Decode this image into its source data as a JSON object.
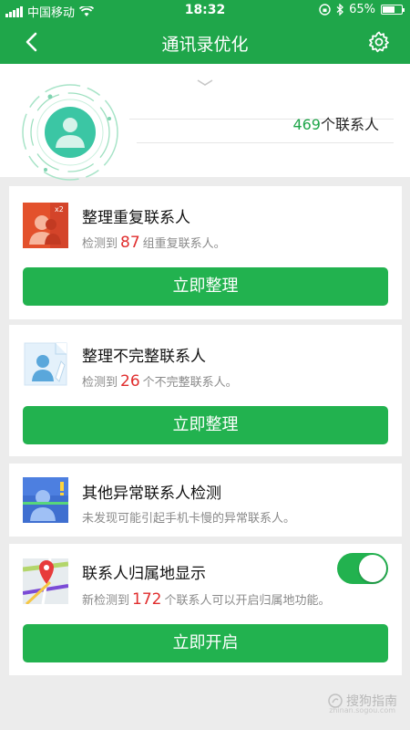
{
  "status": {
    "carrier": "中国移动",
    "time": "18:32",
    "battery": "65%",
    "battery_level": 0.65
  },
  "nav": {
    "title": "通讯录优化",
    "back_icon": "back-arrow-icon",
    "settings_icon": "gear-icon"
  },
  "summary": {
    "count": "469",
    "count_suffix": "个联系人"
  },
  "cards": {
    "duplicate": {
      "title": "整理重复联系人",
      "desc_prefix": "检测到",
      "count": "87",
      "desc_suffix": "组重复联系人。",
      "icon_badge": "x2",
      "button": "立即整理"
    },
    "incomplete": {
      "title": "整理不完整联系人",
      "desc_prefix": "检测到",
      "count": "26",
      "desc_suffix": "个不完整联系人。",
      "button": "立即整理"
    },
    "abnormal": {
      "title": "其他异常联系人检测",
      "desc": "未发现可能引起手机卡慢的异常联系人。"
    },
    "location": {
      "title": "联系人归属地显示",
      "desc_prefix": "新检测到",
      "count": "172",
      "desc_suffix": "个联系人可以开启归属地功能。",
      "toggle_on": true,
      "button": "立即开启"
    }
  },
  "watermark": {
    "text": "搜狗指南",
    "sub": "zhinan.sogou.com"
  },
  "colors": {
    "primary": "#1fa64a",
    "button": "#22b24f",
    "highlight": "#e02d2d"
  }
}
